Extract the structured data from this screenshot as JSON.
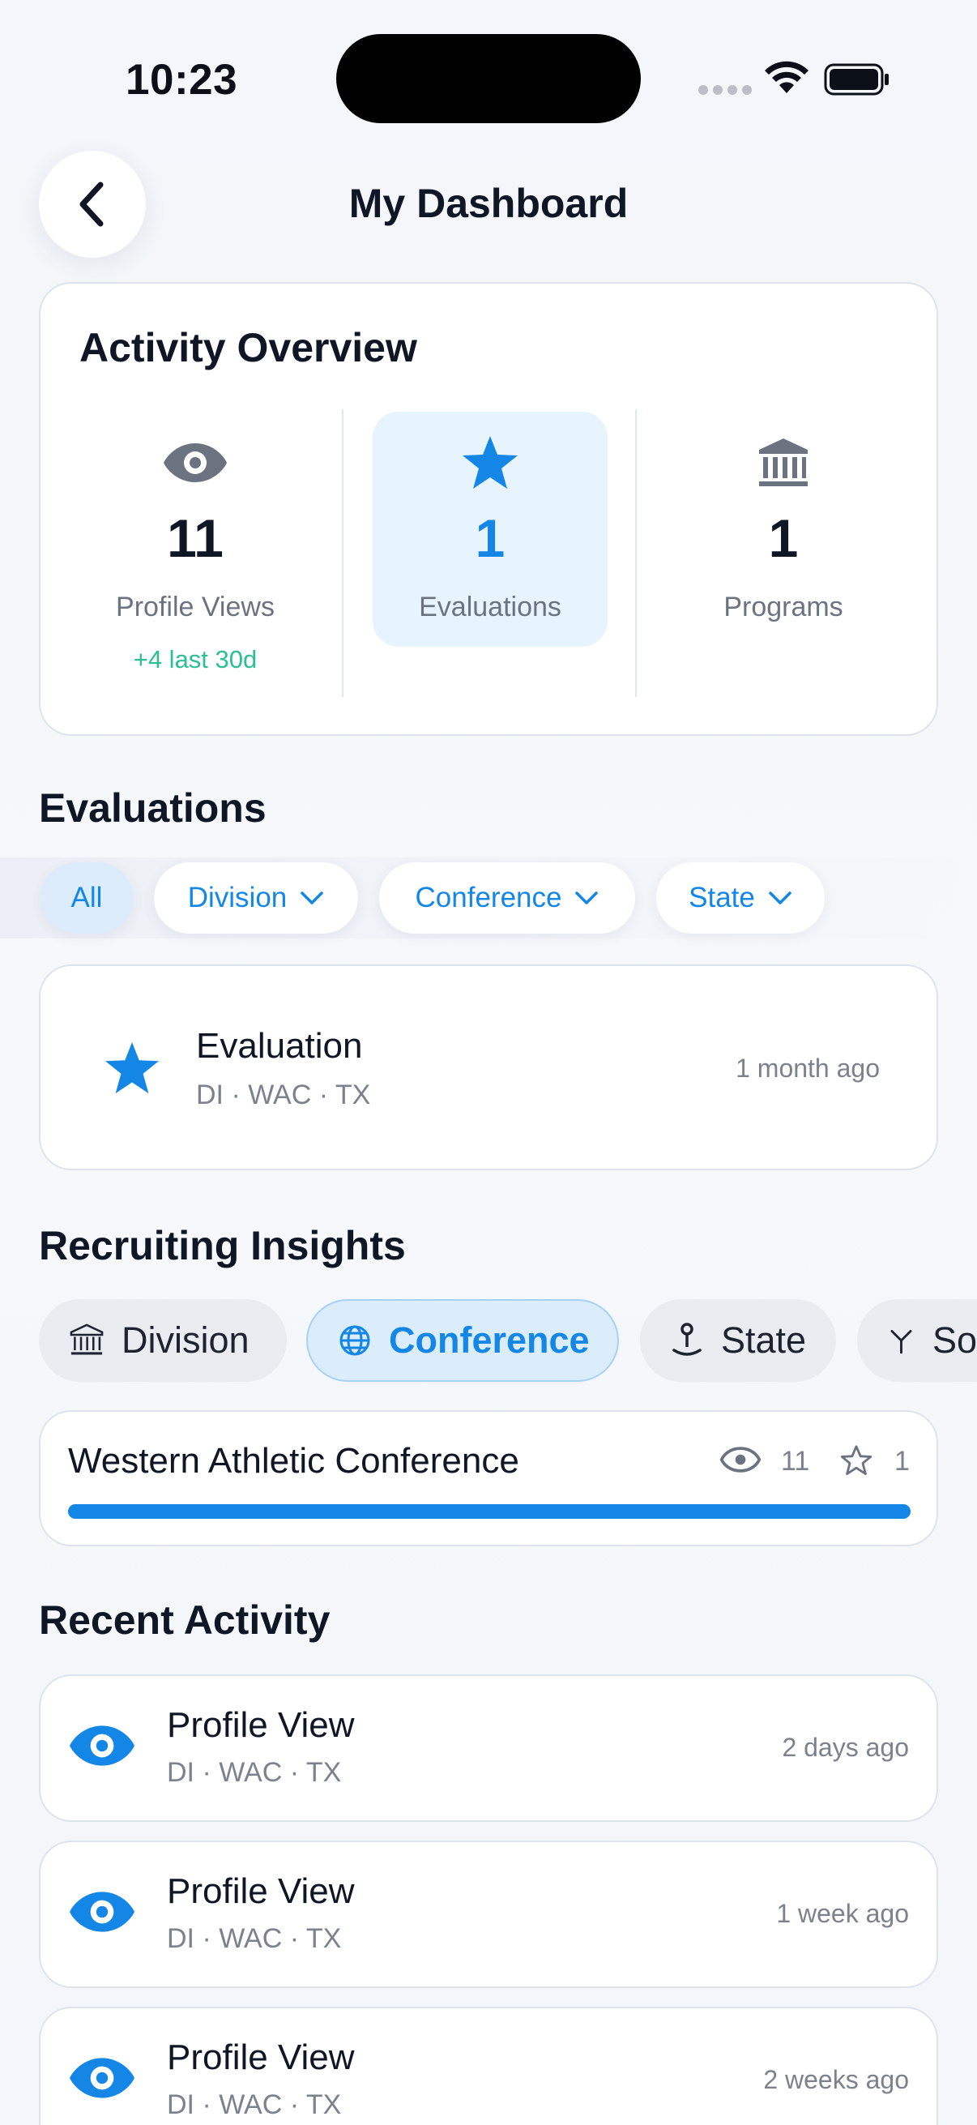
{
  "status_bar": {
    "time": "10:23"
  },
  "header": {
    "title": "My Dashboard",
    "back_icon": "chevron-left-icon"
  },
  "overview": {
    "title": "Activity Overview",
    "stats": [
      {
        "icon": "eye-icon",
        "value": "11",
        "label": "Profile Views",
        "sub": "+4 last 30d"
      },
      {
        "icon": "star-icon",
        "value": "1",
        "label": "Evaluations",
        "active": true
      },
      {
        "icon": "bank-icon",
        "value": "1",
        "label": "Programs"
      }
    ]
  },
  "evaluations": {
    "title": "Evaluations",
    "filters": [
      {
        "label": "All",
        "active": true
      },
      {
        "label": "Division",
        "dropdown": true
      },
      {
        "label": "Conference",
        "dropdown": true
      },
      {
        "label": "State",
        "dropdown": true
      }
    ],
    "items": [
      {
        "icon": "star-icon",
        "title": "Evaluation",
        "meta": "DI · WAC · TX",
        "time": "1 month ago"
      }
    ]
  },
  "insights": {
    "title": "Recruiting Insights",
    "tabs": [
      {
        "icon": "bank-icon",
        "label": "Division"
      },
      {
        "icon": "globe-icon",
        "label": "Conference",
        "active": true
      },
      {
        "icon": "joystick-icon",
        "label": "State"
      },
      {
        "icon": "split-icon",
        "label": "So"
      }
    ],
    "rows": [
      {
        "name": "Western Athletic Conference",
        "views": "11",
        "evaluations": "1",
        "progress": 1.0
      }
    ]
  },
  "recent": {
    "title": "Recent Activity",
    "items": [
      {
        "icon": "eye-icon",
        "title": "Profile View",
        "meta": "DI · WAC · TX",
        "time": "2 days ago"
      },
      {
        "icon": "eye-icon",
        "title": "Profile View",
        "meta": "DI · WAC · TX",
        "time": "1 week ago"
      },
      {
        "icon": "eye-icon",
        "title": "Profile View",
        "meta": "DI · WAC · TX",
        "time": "2 weeks ago"
      }
    ]
  },
  "colors": {
    "accent": "#1487e6",
    "positive": "#2bc090",
    "muted": "#6b7380"
  }
}
